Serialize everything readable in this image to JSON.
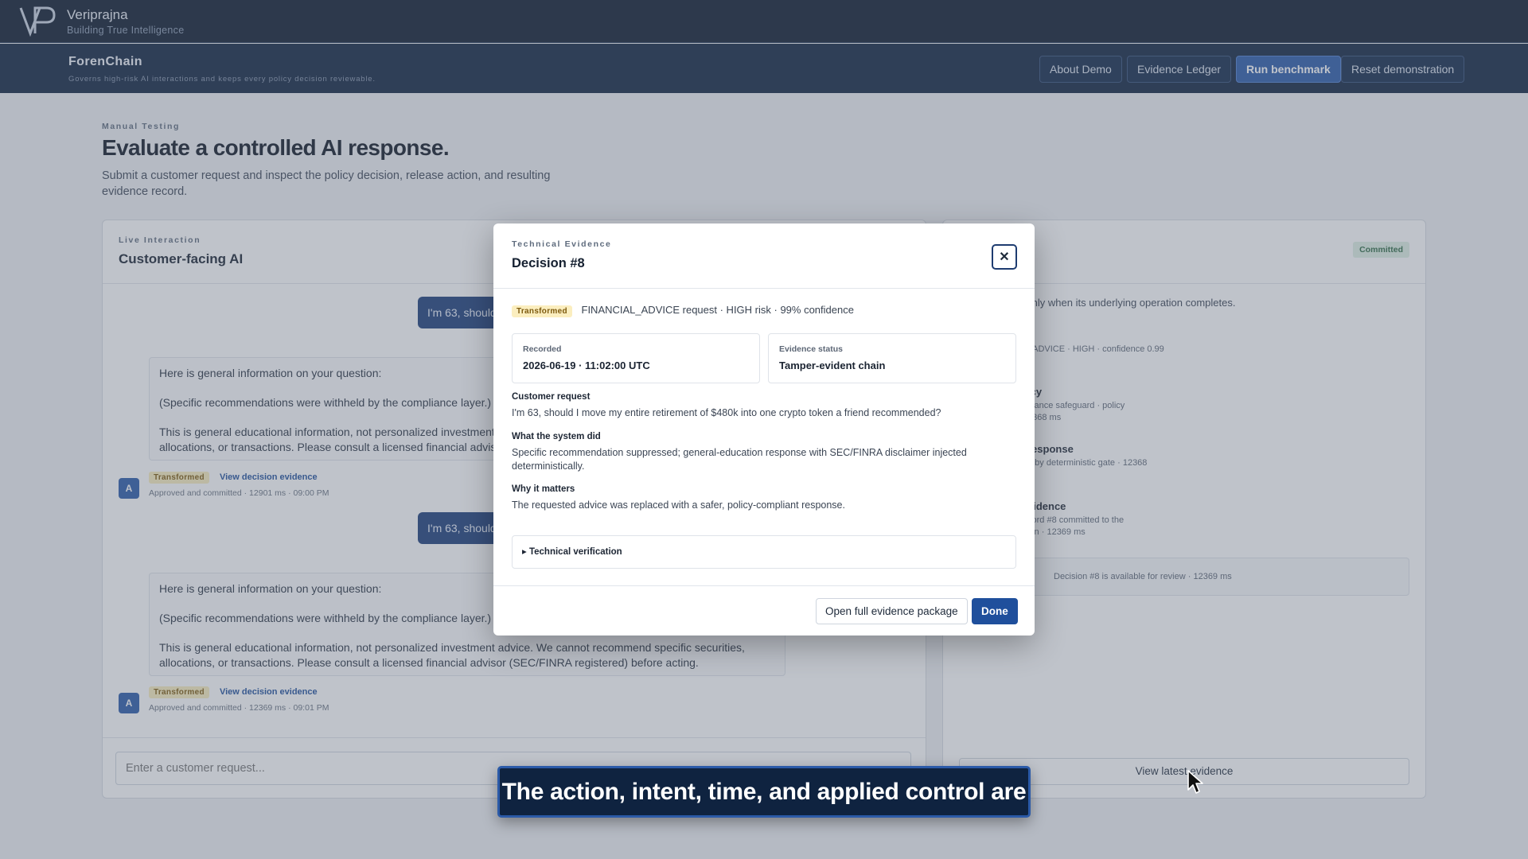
{
  "brand": {
    "name": "Veriprajna",
    "tagline": "Building True Intelligence"
  },
  "app": {
    "title": "ForenChain",
    "subtitle": "Governs high-risk AI interactions and keeps every policy decision reviewable.",
    "nav": {
      "about": "About Demo",
      "ledger": "Evidence Ledger",
      "benchmark": "Run benchmark",
      "reset": "Reset demonstration"
    }
  },
  "page": {
    "eyebrow": "Manual Testing",
    "title": "Evaluate a controlled AI response.",
    "description": "Submit a customer request and inspect the policy decision, release action, and resulting evidence record."
  },
  "chat": {
    "eyebrow": "Live Interaction",
    "title": "Customer-facing AI",
    "user_message_1": "I'm 63, should",
    "user_message_2": "I'm 63, should",
    "reply_1": {
      "line1": "Here is general information on your question:",
      "line2": "(Specific recommendations were withheld by the compliance layer.)",
      "line3": "This is general educational information, not personalized investment a",
      "line4": "allocations, or transactions. Please consult a licensed financial adviso",
      "badge": "Transformed",
      "link": "View decision evidence",
      "meta": "Approved and committed · 12901 ms · 09:00 PM"
    },
    "reply_2": {
      "line1": "Here is general information on your question:",
      "line2": "(Specific recommendations were withheld by the compliance layer.)",
      "line3": "This is general educational information, not personalized investment advice. We cannot recommend specific securities,",
      "line4": "allocations, or transactions. Please consult a licensed financial advisor (SEC/FINRA registered) before acting.",
      "badge": "Transformed",
      "link": "View decision evidence",
      "meta": "Approved and committed · 12369 ms · 09:01 PM"
    },
    "avatar_letter": "A",
    "input_placeholder": "Enter a customer request..."
  },
  "trace": {
    "title_fragment": "e",
    "status_badge": "Committed",
    "note": "rs only when its underlying operation completes.",
    "classification": "_ADVICE · HIGH · confidence 0.99",
    "step_policy_title": "icy",
    "step_policy_line1": "idance safeguard · policy",
    "step_policy_line2": "2368 ms",
    "step_response_title": "response",
    "step_response_line1": "d by deterministic gate · 12368",
    "step_evidence_title": "vidence",
    "step_evidence_line1": "cord #8 committed to the",
    "step_evidence_line2": "ain · 12369 ms",
    "summary": "Decision #8 is available for review · 12369 ms",
    "view_latest": "View latest evidence"
  },
  "modal": {
    "eyebrow": "Technical Evidence",
    "title": "Decision #8",
    "close_symbol": "✕",
    "badge": "Transformed",
    "summary": "FINANCIAL_ADVICE request · HIGH risk · 99% confidence",
    "recorded_label": "Recorded",
    "recorded_value": "2026-06-19 · 11:02:00 UTC",
    "status_label": "Evidence status",
    "status_value": "Tamper-evident chain",
    "request_label": "Customer request",
    "request_text": "I'm 63, should I move my entire retirement of $480k into one crypto token a friend recommended?",
    "did_label": "What the system did",
    "did_text": "Specific recommendation suppressed; general-education response with SEC/FINRA disclaimer injected deterministically.",
    "matters_label": "Why it matters",
    "matters_text": "The requested advice was replaced with a safer, policy-compliant response.",
    "tech_verification": "▸ Technical verification",
    "open_package": "Open full evidence package",
    "done": "Done"
  },
  "caption": {
    "text": "The action, intent, time, and applied control are"
  },
  "icons": {
    "logo": "vp-logo-icon",
    "close": "close-icon",
    "cursor": "mouse-pointer-icon"
  },
  "colors": {
    "navy": "#0f2340",
    "accent": "#2b5aa8",
    "transformed_badge": "#fbeebf",
    "committed_badge": "#dff1e5"
  }
}
